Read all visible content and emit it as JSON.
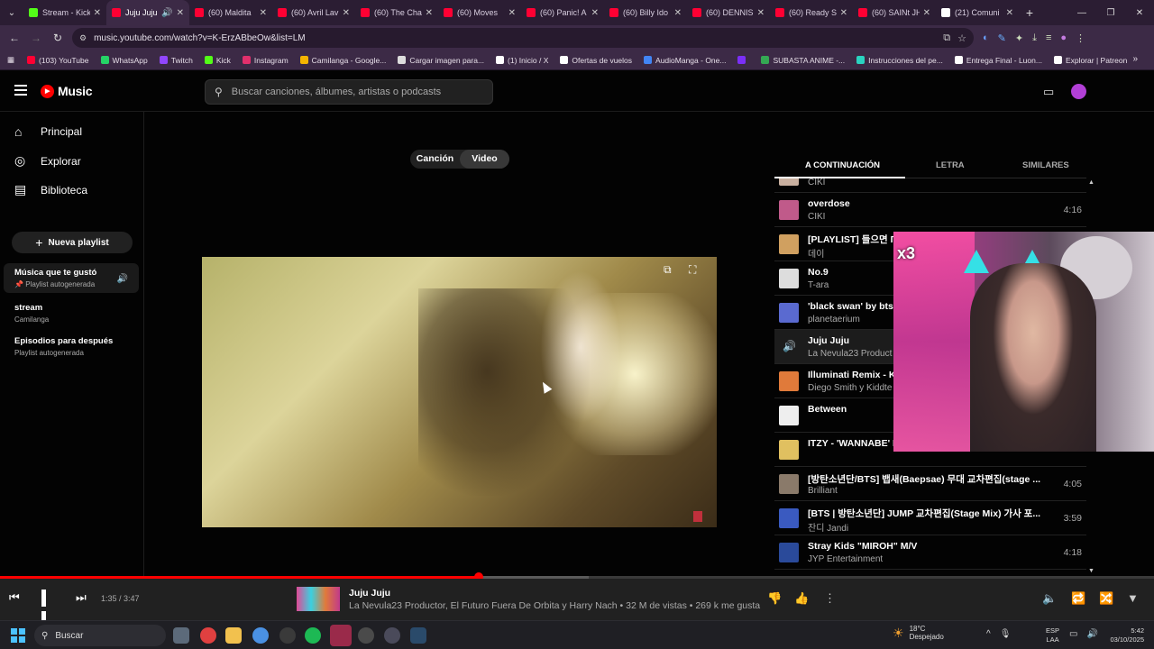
{
  "browser": {
    "tabs": [
      {
        "label": "Stream - Kick",
        "color": "#53fc18",
        "active": false
      },
      {
        "label": "Juju Juju",
        "color": "#ff0033",
        "active": true
      },
      {
        "label": "(60) Maldita",
        "color": "#ff0033",
        "active": false
      },
      {
        "label": "(60) Avril Lav",
        "color": "#ff0033",
        "active": false
      },
      {
        "label": "(60) The Cha",
        "color": "#ff0033",
        "active": false
      },
      {
        "label": "(60) Moves",
        "color": "#ff0033",
        "active": false
      },
      {
        "label": "(60) Panic! A",
        "color": "#ff0033",
        "active": false
      },
      {
        "label": "(60) Billy Ido",
        "color": "#ff0033",
        "active": false
      },
      {
        "label": "(60) DENNIS",
        "color": "#ff0033",
        "active": false
      },
      {
        "label": "(60) Ready S",
        "color": "#ff0033",
        "active": false
      },
      {
        "label": "(60) SAINt JH",
        "color": "#ff0033",
        "active": false
      },
      {
        "label": "(21) Comuni",
        "color": "#ffffff",
        "active": false
      }
    ],
    "url": "music.youtube.com/watch?v=K-ErzABbeOw&list=LM",
    "bookmarks": [
      {
        "label": "(103) YouTube",
        "color": "#ff0033"
      },
      {
        "label": "WhatsApp",
        "color": "#25d366"
      },
      {
        "label": "Twitch",
        "color": "#9146ff"
      },
      {
        "label": "Kick",
        "color": "#53fc18"
      },
      {
        "label": "Instagram",
        "color": "#e1306c"
      },
      {
        "label": "Camilanga - Google...",
        "color": "#f4b400"
      },
      {
        "label": "Cargar imagen para...",
        "color": "#dddddd"
      },
      {
        "label": "(1) Inicio / X",
        "color": "#ffffff"
      },
      {
        "label": "Ofertas de vuelos",
        "color": "#ffffff"
      },
      {
        "label": "AudioManga - One...",
        "color": "#4285f4"
      },
      {
        "label": "",
        "color": "#7b2ff7"
      },
      {
        "label": "SUBASTA ANIME -...",
        "color": "#34a853"
      },
      {
        "label": "Instrucciones del pe...",
        "color": "#2ad3c0"
      },
      {
        "label": "Entrega Final - Luon...",
        "color": "#ffffff"
      },
      {
        "label": "Explorar | Patreon",
        "color": "#ffffff"
      }
    ]
  },
  "header": {
    "logo": "Music",
    "search_placeholder": "Buscar canciones, álbumes, artistas o podcasts"
  },
  "sidebar": {
    "nav": [
      {
        "label": "Principal",
        "icon": "home-icon"
      },
      {
        "label": "Explorar",
        "icon": "compass-icon"
      },
      {
        "label": "Biblioteca",
        "icon": "library-icon"
      }
    ],
    "new_playlist": "Nueva playlist",
    "playlists": [
      {
        "name": "Música que te gustó",
        "sub": "Playlist autogenerada",
        "selected": true
      },
      {
        "name": "stream",
        "sub": "Camilanga",
        "selected": false
      },
      {
        "name": "Episodios para después",
        "sub": "Playlist autogenerada",
        "selected": false
      }
    ]
  },
  "main": {
    "toggle": {
      "song": "Canción",
      "video": "Video"
    }
  },
  "right_panel": {
    "tabs": [
      "A CONTINUACIÓN",
      "LETRA",
      "SIMILARES"
    ],
    "partial_top_sub": "CIKI",
    "queue": [
      {
        "title": "overdose",
        "sub": "CIKI",
        "dur": "4:16",
        "color": "#c05a8a"
      },
      {
        "title": "[PLAYLIST] 들으면 Г",
        "sub": "데이",
        "dur": "",
        "color": "#d0a060"
      },
      {
        "title": "No.9",
        "sub": "T-ara",
        "dur": "",
        "color": "#dddddd"
      },
      {
        "title": "'black swan' by bts e",
        "sub": "planetaerium",
        "dur": "",
        "color": "#5a6ad0"
      },
      {
        "title": "Juju Juju",
        "sub": "La Nevula23 Product",
        "dur": "",
        "color": "#1c1c1c",
        "playing": true
      },
      {
        "title": "Illuminati Remix - Ki",
        "sub": "Diego Smith y Kiddte",
        "dur": "",
        "color": "#e07a3a"
      },
      {
        "title": "Between",
        "sub": "",
        "dur": "",
        "color": "#eeeeee"
      },
      {
        "title": "ITZY - 'WANNABE' D",
        "sub": "",
        "dur": "",
        "color": "#e0c060"
      },
      {
        "title": "[방탄소년단/BTS] 뱁새(Baepsae) 무대 교차편집(stage ...",
        "sub": "Brilliant",
        "dur": "4:05",
        "color": "#8a7a6a"
      },
      {
        "title": "[BTS | 방탄소년단] JUMP 교차편집(Stage Mix) 가사 포...",
        "sub": "잔디 Jandi",
        "dur": "3:59",
        "color": "#3a5ac0"
      },
      {
        "title": "Stray Kids \"MIROH\" M/V",
        "sub": "JYP Entertainment",
        "dur": "4:18",
        "color": "#2a4a9a"
      }
    ]
  },
  "overlay": {
    "badge": "x3"
  },
  "player": {
    "time": "1:35 / 3:47",
    "progress": 0.415,
    "buffered": 0.51,
    "title": "Juju Juju",
    "subtitle": "La Nevula23 Productor, El Futuro Fuera De Orbita y Harry Nach • 32 M de vistas • 269 k me gusta"
  },
  "taskbar": {
    "search": "Buscar",
    "weather_temp": "18°C",
    "weather_desc": "Despejado",
    "lang1": "ESP",
    "lang2": "LAA",
    "time": "5:42",
    "date": "03/10/2025"
  }
}
